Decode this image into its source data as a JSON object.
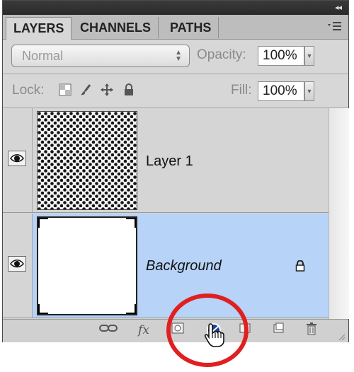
{
  "tabs": [
    {
      "label": "LAYERS"
    },
    {
      "label": "CHANNELS"
    },
    {
      "label": "PATHS"
    }
  ],
  "blend_mode": {
    "value": "Normal"
  },
  "opacity": {
    "label": "Opacity:",
    "value": "100%"
  },
  "lock": {
    "label": "Lock:"
  },
  "fill": {
    "label": "Fill:",
    "value": "100%"
  },
  "layers": [
    {
      "name": "Layer 1",
      "visible": true,
      "thumbnail": "dot-pattern"
    },
    {
      "name": "Background",
      "visible": true,
      "thumbnail": "white",
      "selected": true,
      "locked": true
    }
  ],
  "bottom_icons": [
    "link-layers-icon",
    "fx-icon",
    "mask-icon",
    "adjustment-layer-icon",
    "group-folder-icon",
    "new-layer-icon",
    "trash-icon"
  ],
  "colors": {
    "selection": "#b7d3f7",
    "highlight_circle": "#e02020"
  },
  "fx_text": "fx"
}
